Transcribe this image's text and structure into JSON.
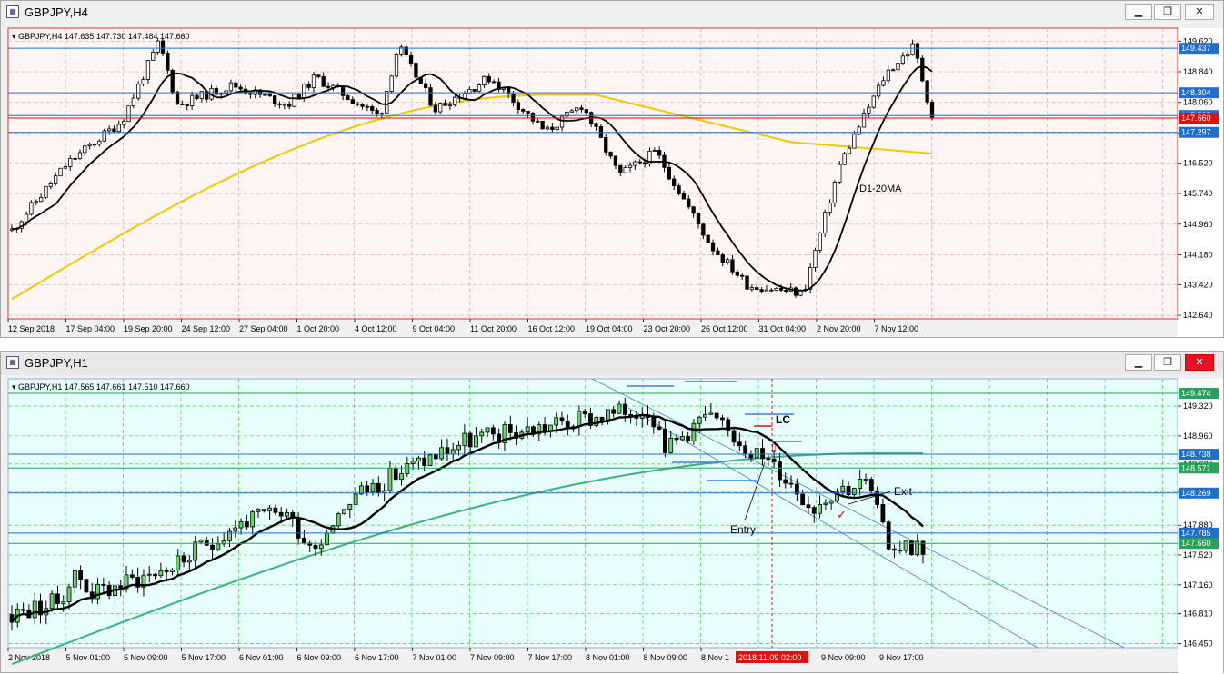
{
  "top": {
    "window_title": "GBPJPY,H4",
    "header": "GBPJPY,H4  147.635 147.730 147.484 147.660",
    "y_ticks": [
      "149.620",
      "148.840",
      "148.060",
      "147.280",
      "146.520",
      "145.740",
      "144.960",
      "144.180",
      "143.420",
      "142.640"
    ],
    "x_labels": [
      "12 Sep 2018",
      "17 Sep 04:00",
      "19 Sep 20:00",
      "24 Sep 12:00",
      "27 Sep 04:00",
      "1 Oct 20:00",
      "4 Oct 12:00",
      "9 Oct 04:00",
      "11 Oct 20:00",
      "16 Oct 12:00",
      "19 Oct 04:00",
      "23 Oct 20:00",
      "26 Oct 12:00",
      "31 Oct 04:00",
      "2 Nov 20:00",
      "7 Nov 12:00"
    ],
    "hlines": [
      {
        "price": "149.437",
        "color": "#1f6fd0"
      },
      {
        "price": "148.304",
        "color": "#1f6fd0"
      },
      {
        "price": "147.725",
        "color": "#1f6fd0"
      },
      {
        "price": "147.297",
        "color": "#1f6fd0"
      }
    ],
    "current_price": "147.660",
    "annotation": "D1-20MA",
    "colors": {
      "bg": "#fff5f5",
      "grid": "#f1a9a9",
      "frame": "#e03030",
      "ma_slow": "#f0c800",
      "ma_fast": "#000000"
    }
  },
  "bottom": {
    "window_title": "GBPJPY,H1",
    "header": "GBPJPY,H1  147.565 147.661 147.510 147.660",
    "y_ticks": [
      "149.320",
      "148.960",
      "148.620",
      "148.280",
      "147.880",
      "147.520",
      "147.160",
      "146.810",
      "146.450"
    ],
    "x_labels": [
      "2 Nov 2018",
      "5 Nov 01:00",
      "5 Nov 09:00",
      "5 Nov 17:00",
      "6 Nov 01:00",
      "6 Nov 09:00",
      "6 Nov 17:00",
      "7 Nov 01:00",
      "7 Nov 09:00",
      "7 Nov 17:00",
      "8 Nov 01:00",
      "8 Nov 09:00",
      "8 Nov 1"
    ],
    "x_highlight": "2018.11.09 02:00",
    "x_labels_right": [
      "9 Nov 09:00",
      "9 Nov 17:00"
    ],
    "hlines": [
      {
        "price": "149.474",
        "color": "#2aa05a"
      },
      {
        "price": "148.738",
        "color": "#1f6fd0"
      },
      {
        "price": "148.571",
        "color": "#2aa05a"
      },
      {
        "price": "148.269",
        "color": "#1f6fd0"
      },
      {
        "price": "147.785",
        "color": "#1f6fd0"
      }
    ],
    "current_price": "147.660",
    "labels": {
      "lc": "LC",
      "entry": "Entry",
      "exit": "Exit"
    },
    "colors": {
      "bg": "#e8fefe",
      "grid": "#5cd35c",
      "ma_slow": "#3cb37a",
      "ma_fast": "#000000"
    }
  }
}
